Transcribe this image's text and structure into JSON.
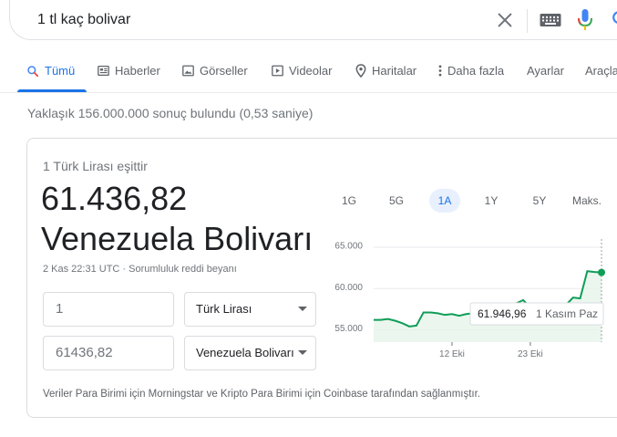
{
  "search": {
    "query": "1 tl kaç bolivar"
  },
  "tabs": [
    {
      "label": "Tümü"
    },
    {
      "label": "Haberler"
    },
    {
      "label": "Görseller"
    },
    {
      "label": "Videolar"
    },
    {
      "label": "Haritalar"
    },
    {
      "label": "Daha fazla"
    },
    {
      "label": "Ayarlar"
    },
    {
      "label": "Araçlar"
    }
  ],
  "result_stats": "Yaklaşık 156.000.000 sonuç bulundu (0,53 saniye)",
  "converter": {
    "equals_label": "1 Türk Lirası eşittir",
    "amount": "61.436,82",
    "currency_name": "Venezuela Bolivarı",
    "timestamp": "2 Kas 22:31 UTC · Sorumluluk reddi beyanı",
    "from_value": "1",
    "from_currency": "Türk Lirası",
    "to_value": "61436,82",
    "to_currency": "Venezuela Bolivarı",
    "footer": "Veriler Para Birimi için Morningstar ve Kripto Para Birimi için Coinbase tarafından sağlanmıştır."
  },
  "ranges": [
    "1G",
    "5G",
    "1A",
    "1Y",
    "5Y",
    "Maks."
  ],
  "active_range": "1A",
  "tooltip": {
    "value": "61.946,96",
    "date": "1 Kasım Paz"
  },
  "colors": {
    "accent": "#1a73e8",
    "line": "#0f9d58"
  },
  "chart_data": {
    "type": "area",
    "ylim": [
      53500,
      66000
    ],
    "yticks": [
      "65.000",
      "60.000",
      "55.000"
    ],
    "yticks_values": [
      65000,
      60000,
      55000
    ],
    "xticks": [
      "12 Eki",
      "23 Eki"
    ],
    "xticks_index": [
      11,
      22
    ],
    "values": [
      56200,
      56200,
      56300,
      56100,
      55800,
      55400,
      55500,
      57100,
      57100,
      57000,
      56800,
      56900,
      56700,
      56900,
      57000,
      57100,
      57300,
      57600,
      57800,
      58100,
      58200,
      58600,
      57700,
      57600,
      57700,
      57600,
      57800,
      58000,
      58900,
      58800,
      62100,
      62000,
      61947
    ]
  }
}
